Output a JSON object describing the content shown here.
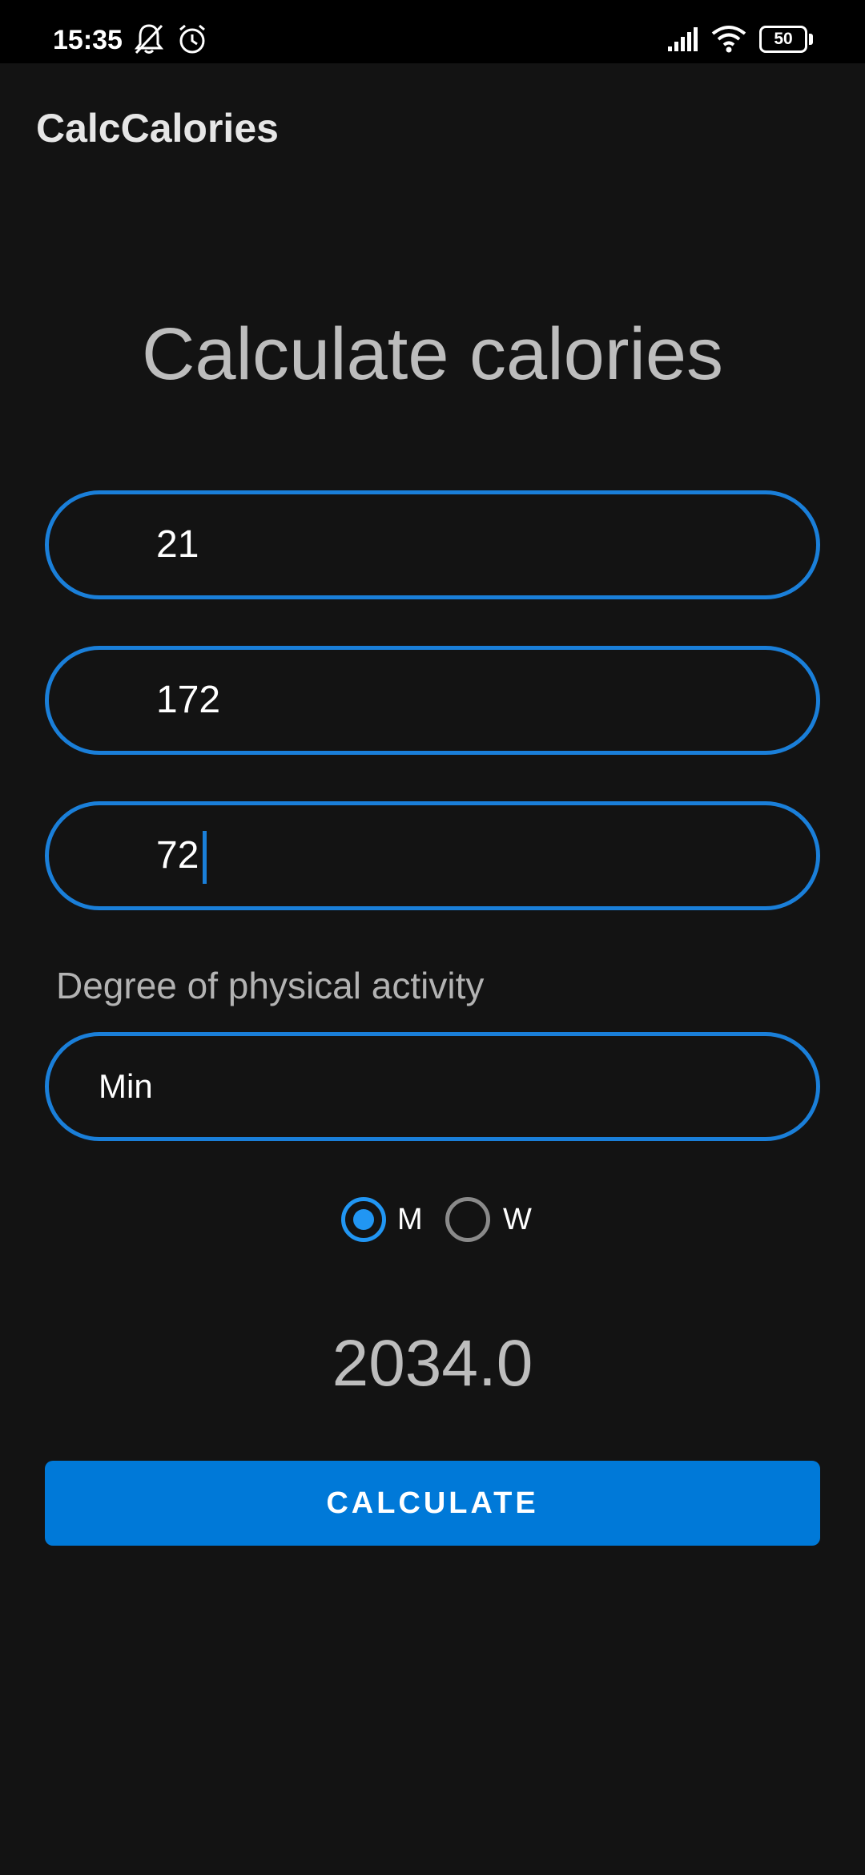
{
  "status_bar": {
    "time": "15:35",
    "battery": "50",
    "icons": [
      "notifications-off-icon",
      "alarm-icon",
      "signal-icon",
      "wifi-icon",
      "battery-icon"
    ]
  },
  "app_bar": {
    "title": "CalcCalories"
  },
  "main": {
    "heading": "Calculate calories",
    "fields": {
      "age": "21",
      "height": "172",
      "weight": "72"
    },
    "activity_label": "Degree of physical activity",
    "activity_selected": "Min",
    "gender": {
      "options": [
        {
          "label": "M",
          "checked": true
        },
        {
          "label": "W",
          "checked": false
        }
      ]
    },
    "result": "2034.0",
    "calculate_label": "CALCULATE"
  },
  "colors": {
    "background": "#131313",
    "accent": "#1a7fd9",
    "button": "#0079d8",
    "status_bar": "#000000"
  }
}
